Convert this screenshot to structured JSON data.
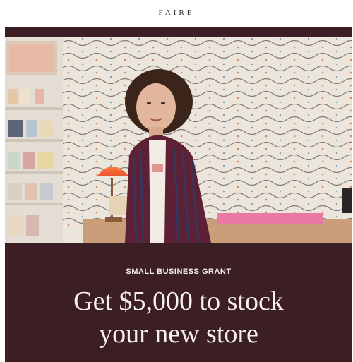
{
  "header": {
    "logo": "FAIRE"
  },
  "hero": {
    "image": "photo-of-shop-owner-in-store"
  },
  "promo": {
    "eyebrow": "SMALL BUSINESS GRANT",
    "headline_line1": "Get $5,000 to stock",
    "headline_line2": "your new store"
  },
  "colors": {
    "background": "#3b1f24",
    "text": "#f7f1ec",
    "accent_lamp": "#e8532f"
  }
}
